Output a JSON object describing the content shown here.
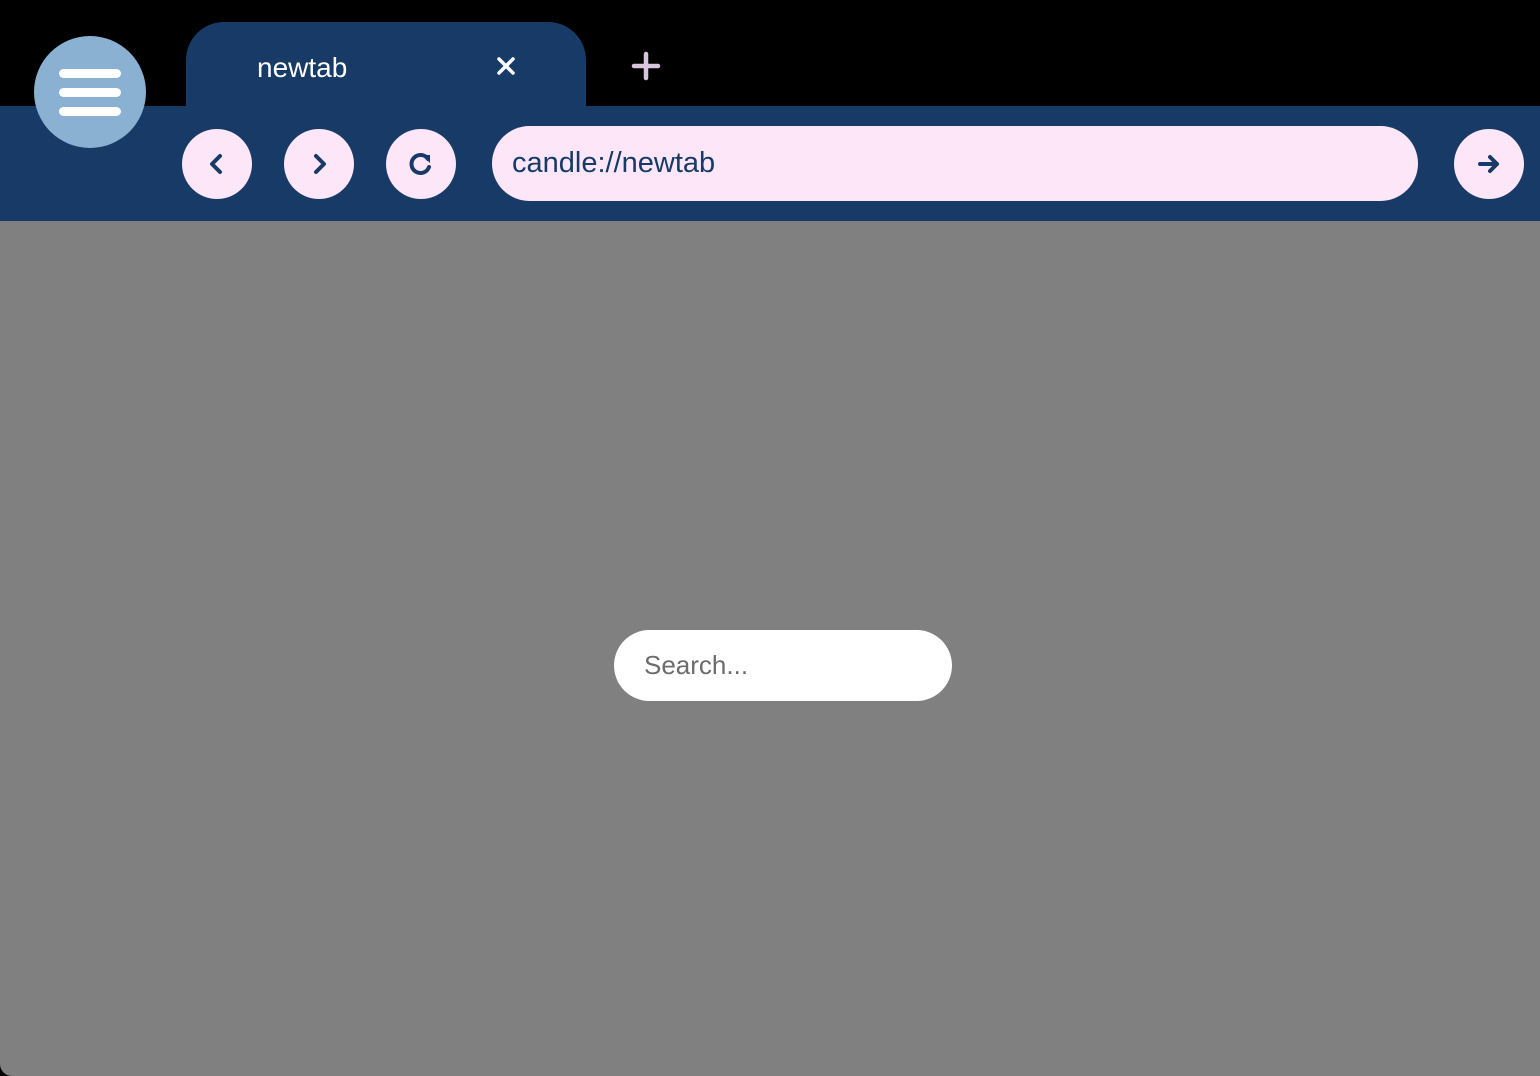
{
  "colors": {
    "tabstrip": "#000000",
    "toolbar": "#173a66",
    "menu_button": "#8ab0d2",
    "pill": "#fce6f8",
    "content": "#808080"
  },
  "menu": {
    "icon": "hamburger-menu-icon"
  },
  "tabs": [
    {
      "title": "newtab",
      "active": true,
      "close_icon": "close-icon"
    }
  ],
  "new_tab": {
    "icon": "plus-icon"
  },
  "toolbar": {
    "back_icon": "chevron-left-icon",
    "forward_icon": "chevron-right-icon",
    "reload_icon": "reload-icon",
    "url": "candle://newtab",
    "go_icon": "arrow-right-icon"
  },
  "content": {
    "search_placeholder": "Search..."
  }
}
